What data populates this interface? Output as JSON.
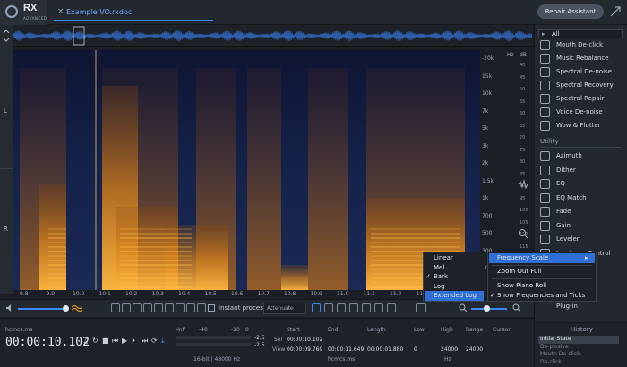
{
  "app": {
    "logo_text": "RX",
    "edition": "ADVANCED",
    "tab_title": "Example VO.rxdoc",
    "repair_assistant": "Repair Assistant"
  },
  "channels": {
    "left": "L",
    "right": "R"
  },
  "freq_axis": {
    "unit": "Hz",
    "labels": [
      "-20k",
      "15k",
      "10k",
      "7k",
      "5k",
      "3k",
      "2k",
      "1.5k",
      "1k",
      "700",
      "500",
      "300",
      "100"
    ]
  },
  "db_axis": {
    "unit": "dB",
    "labels": [
      "40",
      "45",
      "50",
      "55",
      "60",
      "65",
      "70",
      "75",
      "80",
      "85",
      "90",
      "95",
      "100",
      "105",
      "110",
      "115"
    ]
  },
  "time_axis": {
    "labels": [
      "9.8",
      "9.9",
      "10.0",
      "10.1",
      "10.2",
      "10.3",
      "10.4",
      "10.5",
      "10.6",
      "10.7",
      "10.8",
      "10.9",
      "11.0",
      "11.1",
      "11.2",
      "11.3",
      "11.4",
      "11.5"
    ]
  },
  "toolbar": {
    "instant_process": "Instant process",
    "attenuate": "Attenuate"
  },
  "status": {
    "format": "hcmcs.ms",
    "timecode": "00:00:10.102",
    "meter_labels": [
      "-Inf.",
      "-40",
      "-10",
      "0"
    ],
    "meter_values": [
      "-2.5",
      "-2.5"
    ],
    "bit_depth": "16-bit | 48000 Hz",
    "sel_label": "Sel",
    "view_label": "View",
    "start_header": "Start",
    "end_header": "End",
    "length_header": "Length",
    "sel_start": "00:00:10.102",
    "view_start": "00:00:09.769",
    "view_end": "00:00:11.649",
    "view_length": "00:00:01.880",
    "sel_units": "hcmcs.ms",
    "low_header": "Low",
    "high_header": "High",
    "range_header": "Range",
    "cursor_header": "Cursor",
    "low": "0",
    "high": "24000",
    "range": "24000",
    "hz": "Hz"
  },
  "right_panel": {
    "filter": "All",
    "modules_top": [
      "Mouth De-click",
      "Music Rebalance",
      "Spectral De-noise",
      "Spectral Recovery",
      "Spectral Repair",
      "Voice De-noise",
      "Wow & Flutter"
    ],
    "utility_header": "Utility",
    "modules_utility": [
      "Azimuth",
      "Dither",
      "EQ",
      "EQ Match",
      "Fade",
      "Gain",
      "Leveler",
      "Loudness Control"
    ],
    "plugin": "Plug-in",
    "history_header": "History",
    "history": [
      "Initial State",
      "De-plosive",
      "Mouth De-click",
      "De-click"
    ]
  },
  "menu_scale": {
    "items": [
      "Linear",
      "Mel",
      "Bark",
      "Log",
      "Extended Log"
    ],
    "checked": "Bark",
    "highlighted": "Extended Log"
  },
  "menu_context": {
    "items": [
      "Frequency Scale",
      "Zoom Out Full",
      "Show Piano Roll",
      "Show Frequencies and Ticks"
    ],
    "checked": "Show Frequencies and Ticks"
  },
  "colors": {
    "accent": "#3a86ff",
    "highlight": "#2f6fd6",
    "spectro_hot": "#f6a623",
    "spectro_bg": "#101a3a"
  }
}
